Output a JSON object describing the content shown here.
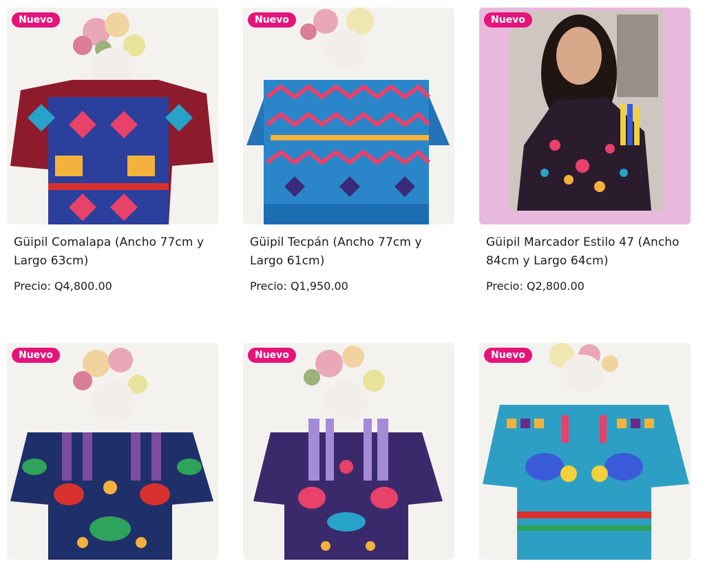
{
  "products": [
    {
      "badge": "Nuevo",
      "title": "Güipil Comalapa (Ancho 77cm y Largo 63cm)",
      "price_label": "Precio:",
      "price": "Q4,800.00",
      "image": "guipil-comalapa-photo"
    },
    {
      "badge": "Nuevo",
      "title": "Güipil Tecpán (Ancho 77cm y Largo 61cm)",
      "price_label": "Precio:",
      "price": "Q1,950.00",
      "image": "guipil-tecpan-photo"
    },
    {
      "badge": "Nuevo",
      "title": "Güipil Marcador Estilo 47 (Ancho 84cm y Largo 64cm)",
      "price_label": "Precio:",
      "price": "Q2,800.00",
      "image": "guipil-marcador-photo"
    },
    {
      "badge": "Nuevo",
      "title": "",
      "price_label": "",
      "price": "",
      "image": "guipil-birds-photo"
    },
    {
      "badge": "Nuevo",
      "title": "",
      "price_label": "",
      "price": "",
      "image": "guipil-purple-photo"
    },
    {
      "badge": "Nuevo",
      "title": "",
      "price_label": "",
      "price": "",
      "image": "guipil-turquoise-photo"
    }
  ],
  "colors": {
    "badge": "#e4147b",
    "card_bg": "#f6f4f2",
    "pink_bg": "#e8b9dc"
  }
}
